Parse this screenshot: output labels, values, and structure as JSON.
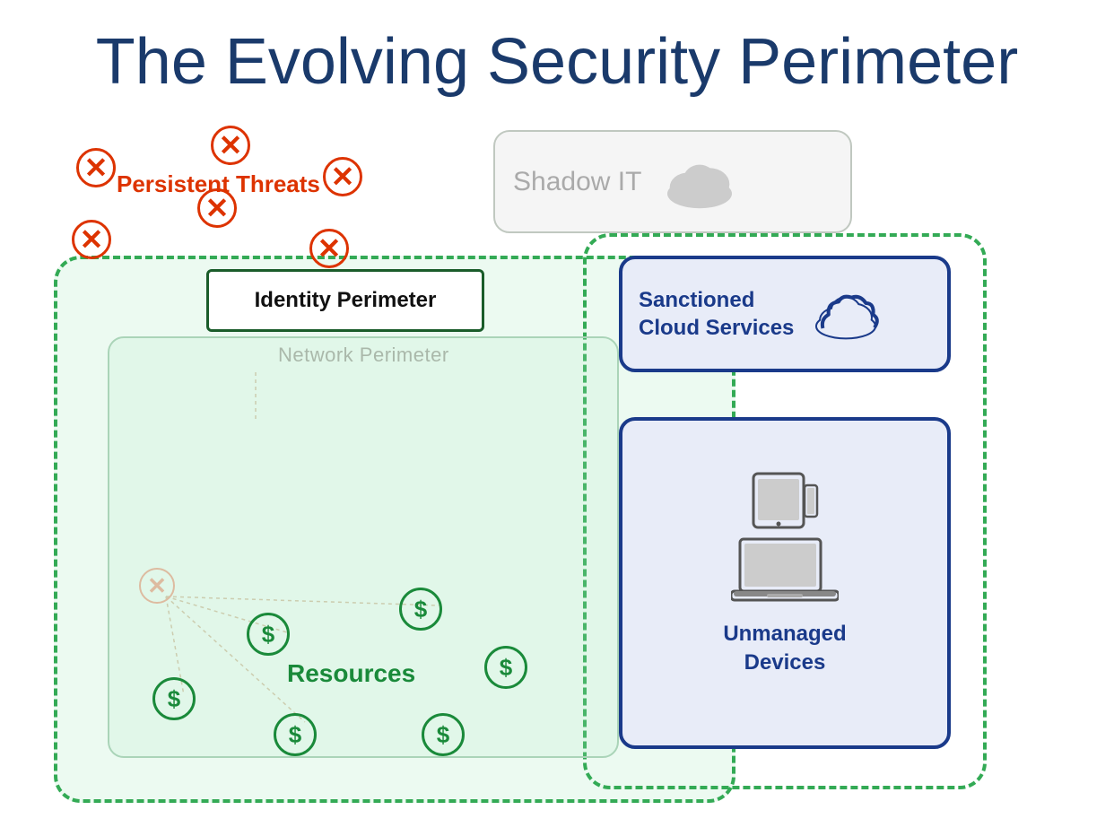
{
  "title": "The Evolving Security Perimeter",
  "labels": {
    "shadow_it": "Shadow IT",
    "identity_perimeter": "Identity Perimeter",
    "network_perimeter": "Network Perimeter",
    "sanctioned_cloud": "Sanctioned\nCloud Services",
    "unmanaged_devices": "Unmanaged\nDevices",
    "resources": "Resources",
    "persistent_threats": "Persistent\nThreats"
  },
  "colors": {
    "dark_blue": "#1a3a6b",
    "navy": "#1a3a8a",
    "green_dark": "#1a8a3a",
    "green_border": "#33aa55",
    "green_light_bg": "rgba(180,235,200,0.25)",
    "red_threat": "#dd3300",
    "gray_shadow": "#aaaaaa",
    "faded_tan": "#ddbba0"
  }
}
